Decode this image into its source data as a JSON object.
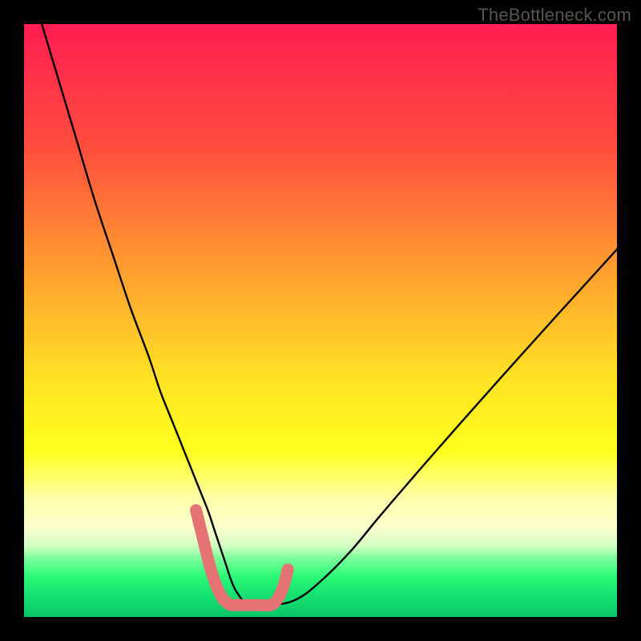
{
  "watermark": "TheBottleneck.com",
  "chart_data": {
    "type": "line",
    "title": "",
    "xlabel": "",
    "ylabel": "",
    "xlim": [
      0,
      100
    ],
    "ylim": [
      0,
      100
    ],
    "legend": false,
    "grid": false,
    "background": {
      "type": "vertical-gradient",
      "stops": [
        {
          "pos": 0.0,
          "color": "#FF1D51"
        },
        {
          "pos": 0.2,
          "color": "#FF4B3E"
        },
        {
          "pos": 0.4,
          "color": "#FF9830"
        },
        {
          "pos": 0.6,
          "color": "#FFE324"
        },
        {
          "pos": 0.72,
          "color": "#FFFF1E"
        },
        {
          "pos": 0.8,
          "color": "#FFFFA9"
        },
        {
          "pos": 0.85,
          "color": "#FBFFCE"
        },
        {
          "pos": 0.88,
          "color": "#D3FFC2"
        },
        {
          "pos": 0.9,
          "color": "#7EFF9C"
        },
        {
          "pos": 0.93,
          "color": "#2EFB77"
        },
        {
          "pos": 0.96,
          "color": "#17E371"
        },
        {
          "pos": 1.0,
          "color": "#09C667"
        }
      ]
    },
    "series": [
      {
        "name": "main-curve",
        "color": "#000000",
        "x": [
          3,
          6,
          9,
          12,
          15,
          18,
          21,
          23,
          25,
          27,
          29,
          31,
          32,
          33,
          34,
          35,
          36,
          38,
          42,
          46,
          50,
          55,
          60,
          66,
          73,
          81,
          90,
          100
        ],
        "y": [
          100,
          90,
          80,
          70,
          61,
          52,
          44,
          38,
          33,
          28,
          23,
          18,
          15,
          12,
          9,
          6,
          4,
          2,
          2,
          3,
          6,
          11,
          17,
          24,
          32,
          41,
          51,
          62
        ]
      },
      {
        "name": "highlight-segment",
        "color": "#E57373",
        "x": [
          29,
          30,
          31.5,
          33,
          34.5,
          36,
          38,
          40,
          42,
          43.5,
          44.5
        ],
        "y": [
          18,
          14,
          8,
          4,
          2.2,
          2,
          2,
          2,
          2.2,
          4.5,
          8
        ]
      }
    ],
    "annotations": []
  }
}
